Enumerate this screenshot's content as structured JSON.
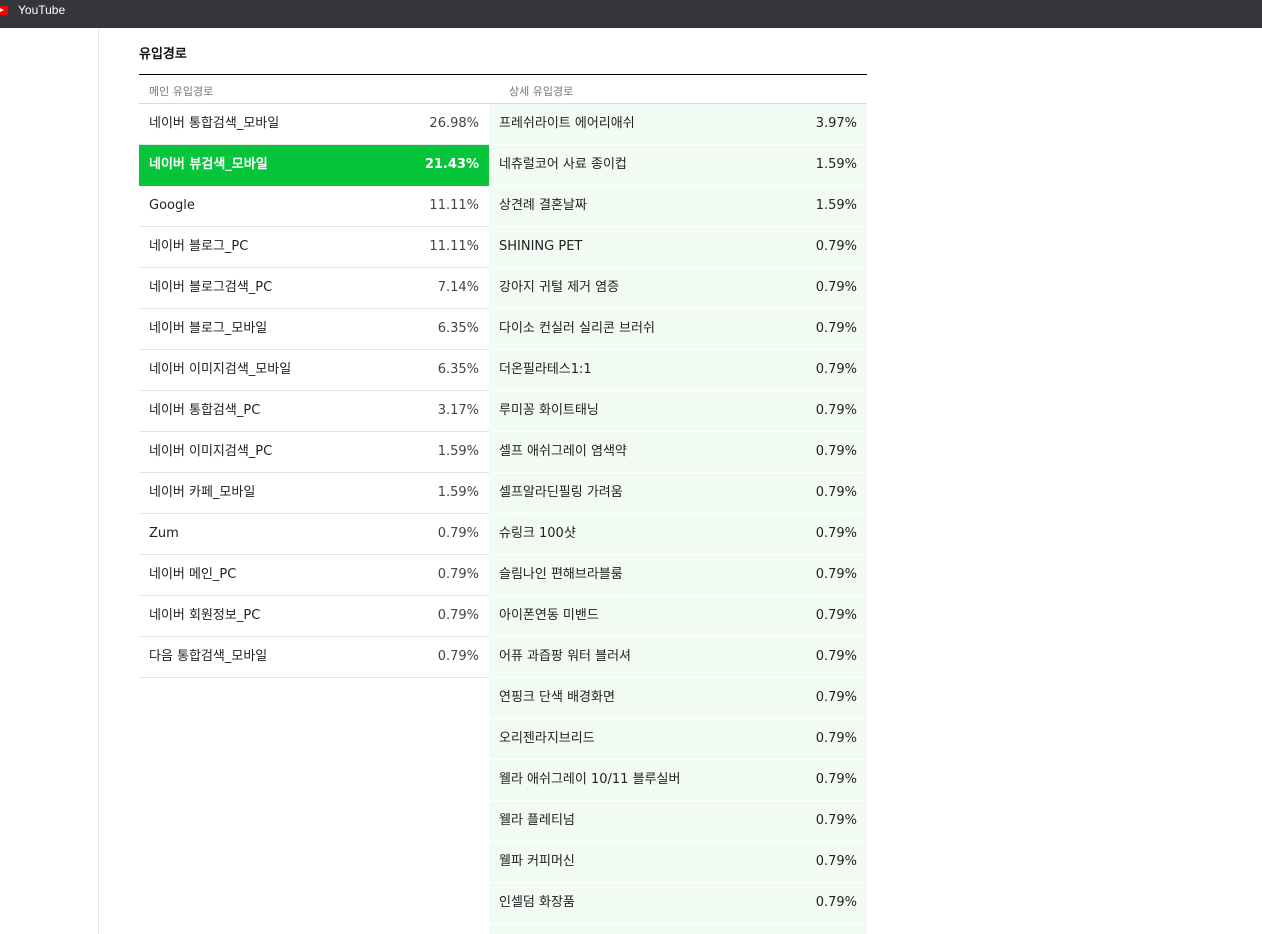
{
  "browser": {
    "tab_title": "YouTube"
  },
  "section": {
    "title": "유입경로",
    "main_header": "메인 유입경로",
    "detail_header": "상세 유입경로"
  },
  "colors": {
    "active_green": "#06c53a",
    "detail_bg": "#f1fbf3"
  },
  "main_sources": [
    {
      "name": "네이버 통합검색_모바일",
      "pct": "26.98%",
      "active": false
    },
    {
      "name": "네이버 뷰검색_모바일",
      "pct": "21.43%",
      "active": true
    },
    {
      "name": "Google",
      "pct": "11.11%",
      "active": false
    },
    {
      "name": "네이버 블로그_PC",
      "pct": "11.11%",
      "active": false
    },
    {
      "name": "네이버 블로그검색_PC",
      "pct": "7.14%",
      "active": false
    },
    {
      "name": "네이버 블로그_모바일",
      "pct": "6.35%",
      "active": false
    },
    {
      "name": "네이버 이미지검색_모바일",
      "pct": "6.35%",
      "active": false
    },
    {
      "name": "네이버 통합검색_PC",
      "pct": "3.17%",
      "active": false
    },
    {
      "name": "네이버 이미지검색_PC",
      "pct": "1.59%",
      "active": false
    },
    {
      "name": "네이버 카페_모바일",
      "pct": "1.59%",
      "active": false
    },
    {
      "name": "Zum",
      "pct": "0.79%",
      "active": false
    },
    {
      "name": "네이버 메인_PC",
      "pct": "0.79%",
      "active": false
    },
    {
      "name": "네이버 회원정보_PC",
      "pct": "0.79%",
      "active": false
    },
    {
      "name": "다음 통합검색_모바일",
      "pct": "0.79%",
      "active": false
    }
  ],
  "detail_sources": [
    {
      "name": "프레쉬라이트 에어리애쉬",
      "pct": "3.97%"
    },
    {
      "name": "네츄럴코어 사료 종이컵",
      "pct": "1.59%"
    },
    {
      "name": "상견례 결혼날짜",
      "pct": "1.59%"
    },
    {
      "name": "SHINING PET",
      "pct": "0.79%"
    },
    {
      "name": "강아지 귀털 제거 염증",
      "pct": "0.79%"
    },
    {
      "name": "다이소 컨실러 실리콘 브러쉬",
      "pct": "0.79%"
    },
    {
      "name": "더온필라테스1:1",
      "pct": "0.79%"
    },
    {
      "name": "루미꽁 화이트태닝",
      "pct": "0.79%"
    },
    {
      "name": "셀프 애쉬그레이 염색약",
      "pct": "0.79%"
    },
    {
      "name": "셀프알라딘필링 가려움",
      "pct": "0.79%"
    },
    {
      "name": "슈링크 100샷",
      "pct": "0.79%"
    },
    {
      "name": "슬림나인 편해브라블룸",
      "pct": "0.79%"
    },
    {
      "name": "아이폰연동 미밴드",
      "pct": "0.79%"
    },
    {
      "name": "어퓨 과즙팡 워터 블러셔",
      "pct": "0.79%"
    },
    {
      "name": "연핑크 단색 배경화면",
      "pct": "0.79%"
    },
    {
      "name": "오리젠라지브리드",
      "pct": "0.79%"
    },
    {
      "name": "웰라 애쉬그레이 10/11 블루실버",
      "pct": "0.79%"
    },
    {
      "name": "웰라 플레티넘",
      "pct": "0.79%"
    },
    {
      "name": "웰파 커피머신",
      "pct": "0.79%"
    },
    {
      "name": "인셀덤 화장품",
      "pct": "0.79%"
    }
  ]
}
